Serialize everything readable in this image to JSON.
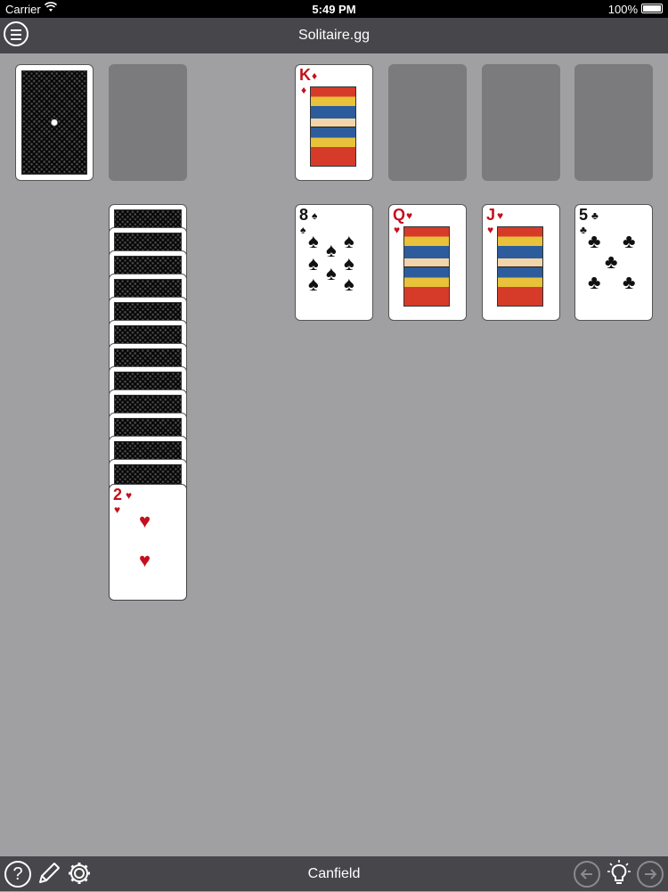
{
  "status_bar": {
    "carrier": "Carrier",
    "time": "5:49 PM",
    "battery": "100%"
  },
  "nav": {
    "title": "Solitaire.gg"
  },
  "bottom": {
    "title": "Canfield",
    "help_label": "?"
  },
  "foundation": {
    "card": {
      "rank": "K",
      "suit": "♦"
    }
  },
  "tableau": [
    {
      "rank": "8",
      "suit": "♠"
    },
    {
      "rank": "Q",
      "suit": "♥"
    },
    {
      "rank": "J",
      "suit": "♥"
    },
    {
      "rank": "5",
      "suit": "♣"
    }
  ],
  "reserve": {
    "facedown_count": 12,
    "top_card": {
      "rank": "2",
      "suit": "♥"
    }
  },
  "colors": {
    "table": "#a09fa1",
    "bar": "#47464a",
    "empty_slot": "#7b7a7c",
    "red_suit": "#c4101d"
  }
}
